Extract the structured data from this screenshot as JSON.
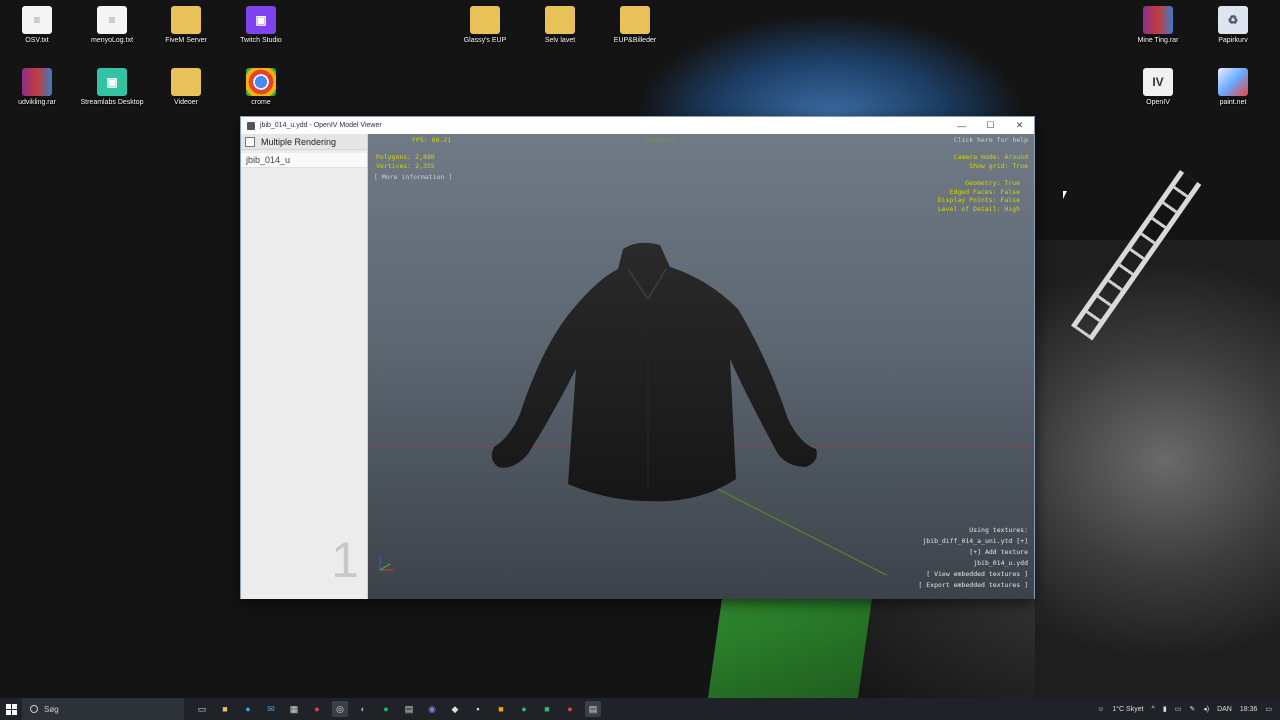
{
  "desktop": {
    "icons": [
      {
        "label": "OSV.txt",
        "icon": "text-file-icon"
      },
      {
        "label": "menyoLog.txt",
        "icon": "text-file-icon"
      },
      {
        "label": "FiveM Server",
        "icon": "folder-icon"
      },
      {
        "label": "Twitch Studio",
        "icon": "twitch-icon"
      },
      {
        "label": "Glassy's EUP",
        "icon": "folder-icon"
      },
      {
        "label": "Selv lavet",
        "icon": "folder-icon"
      },
      {
        "label": "EUP&Billeder",
        "icon": "folder-icon"
      },
      {
        "label": "Mine Ting.rar",
        "icon": "winrar-icon"
      },
      {
        "label": "Papirkurv",
        "icon": "recycle-bin-icon"
      },
      {
        "label": "udvikling.rar",
        "icon": "winrar-icon"
      },
      {
        "label": "Streamlabs Desktop",
        "icon": "streamlabs-icon"
      },
      {
        "label": "Videoer",
        "icon": "folder-icon"
      },
      {
        "label": "crome",
        "icon": "chrome-icon"
      },
      {
        "label": "OpenIV",
        "icon": "openiv-icon"
      },
      {
        "label": "paint.net",
        "icon": "paintnet-icon"
      }
    ]
  },
  "window": {
    "title": "jbib_014_u.ydd - OpenIV Model Viewer",
    "controls": {
      "minimize": "—",
      "maximize": "☐",
      "close": "✕"
    },
    "sidebar": {
      "header": "Multiple Rendering",
      "items": [
        "jbib_014_u"
      ],
      "lod_number": "1"
    },
    "viewport": {
      "fps": "FPS: 60.21",
      "top_center": "Geometry: 1",
      "top_right_link": "Click here for help",
      "stats": "Polygons: 2,898\nVertices: 2,355",
      "more_info": "[ More information ]",
      "camera": "Camera mode: Around\nShow grid: True",
      "settings": "Geometry: True\nEdged Faces: False\nDisplay Points: False\nLevel of Detail: High",
      "textures": "Using textures:\njbib_diff_014_a_uni.ytd [+]\n[+] Add texture\njbib_014_u.ydd\n[ View embedded textures ]\n[ Export embedded textures ]"
    }
  },
  "taskbar": {
    "search_placeholder": "Søg",
    "apps": [
      "task-view-icon",
      "file-explorer-icon",
      "edge-icon",
      "mail-icon",
      "store-icon",
      "chrome-icon",
      "obs-icon",
      "steam-icon",
      "spotify-icon",
      "openiv-icon",
      "discord-icon",
      "media-icon",
      "notepad-icon",
      "rockstar-icon",
      "xbox-icon",
      "game-icon",
      "chrome-icon",
      "paint-icon"
    ],
    "weather": "1°C  Skyet",
    "language": "DAN",
    "time": "18:36"
  }
}
